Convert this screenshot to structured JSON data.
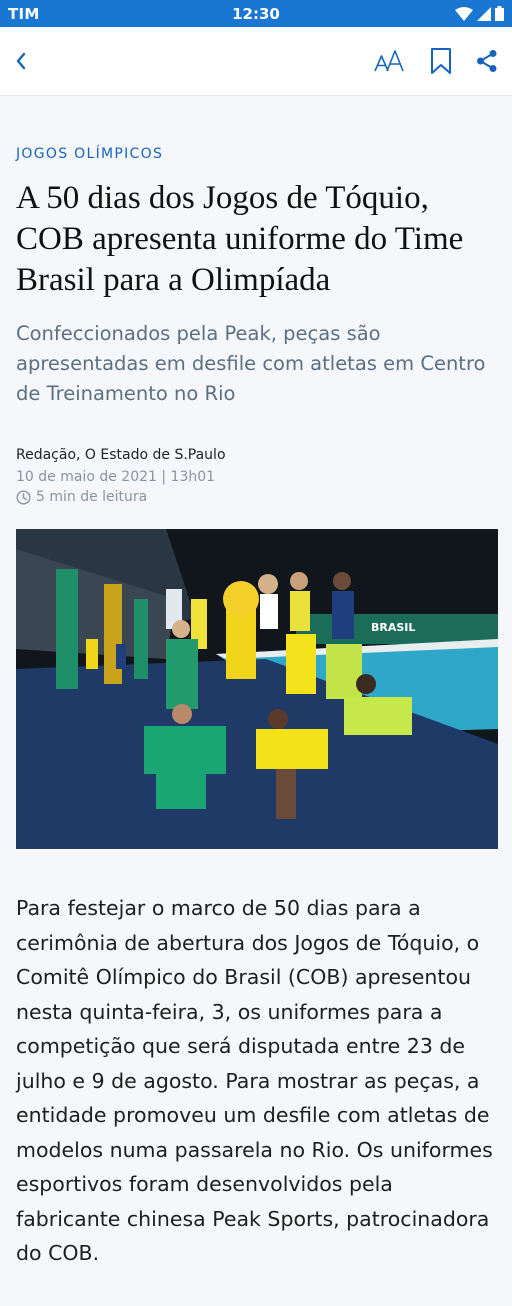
{
  "status_bar": {
    "carrier": "TIM",
    "time": "12:30"
  },
  "toolbar": {
    "back_icon": "chevron-left-icon",
    "font_size_icon": "font-size-icon",
    "bookmark_icon": "bookmark-icon",
    "share_icon": "share-icon",
    "icon_color": "#1565c0"
  },
  "article": {
    "category": "JOGOS OLÍMPICOS",
    "title": "A 50 dias dos Jogos de Tóquio, COB apresenta uniforme do Time Brasil para a Olimpíada",
    "subtitle": "Confeccionados pela Peak, peças são apresentadas em desfile com atletas em Centro de Treinamento no Rio",
    "author": "Redação, O Estado de S.Paulo",
    "date": "10 de maio de 2021 | 13h01",
    "read_time": "5 min de leitura",
    "photo_sign": "BRASIL",
    "body": "Para festejar o marco de 50 dias para a cerimônia de abertura dos Jogos de Tóquio, o Comitê Olímpico do Brasil (COB) apresentou nesta quinta-feira, 3, os uniformes para a competição que será disputada entre 23 de julho e 9 de agosto. Para mostrar as peças, a entidade promoveu um desfile com atletas de modelos numa passarela no Rio. Os uniformes esportivos foram desenvolvidos pela fabricante chinesa Peak Sports, patrocinadora do COB."
  },
  "colors": {
    "status_bar": "#1976d2",
    "accent": "#1565c0",
    "subtitle": "#5b6f82",
    "meta": "#8a949d",
    "background": "#f5f7fa"
  }
}
